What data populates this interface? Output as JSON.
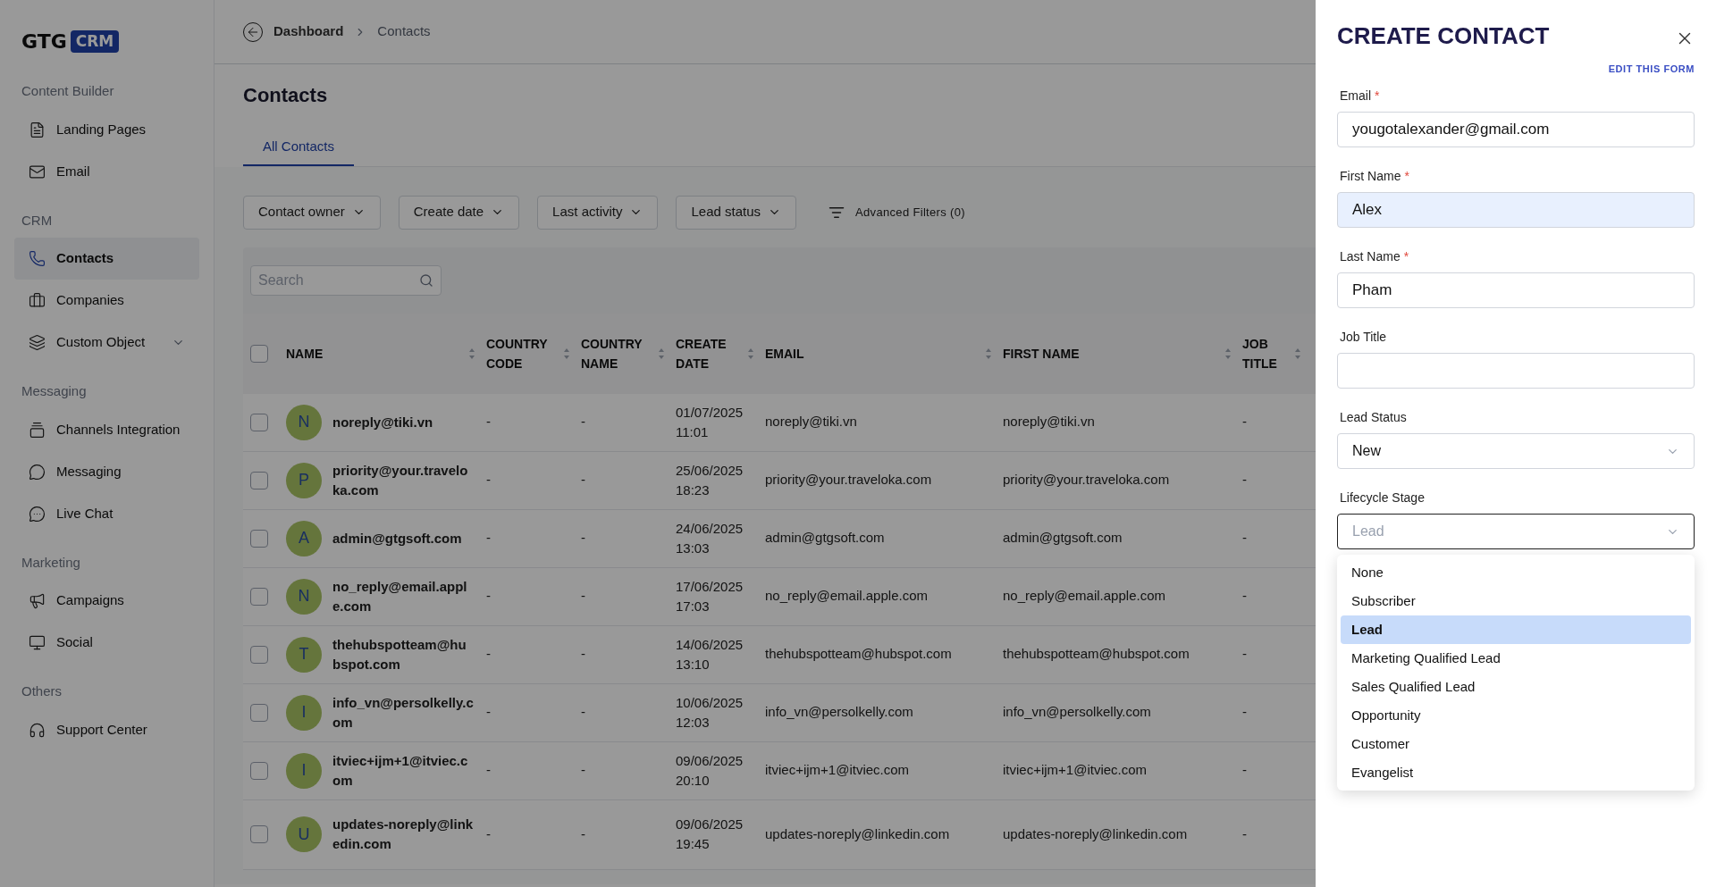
{
  "sidebar": {
    "logo": {
      "text": "GTG",
      "badge": "CRM"
    },
    "sections": [
      {
        "title": "Content Builder",
        "items": [
          {
            "label": "Landing Pages",
            "selected": false
          },
          {
            "label": "Email",
            "selected": false
          }
        ]
      },
      {
        "title": "CRM",
        "items": [
          {
            "label": "Contacts",
            "selected": true
          },
          {
            "label": "Companies",
            "selected": false
          },
          {
            "label": "Custom Object",
            "selected": false,
            "expandable": true
          }
        ]
      },
      {
        "title": "Messaging",
        "items": [
          {
            "label": "Channels Integration",
            "selected": false
          },
          {
            "label": "Messaging",
            "selected": false
          },
          {
            "label": "Live Chat",
            "selected": false
          }
        ]
      },
      {
        "title": "Marketing",
        "items": [
          {
            "label": "Campaigns",
            "selected": false
          },
          {
            "label": "Social",
            "selected": false
          }
        ]
      },
      {
        "title": "Others",
        "items": [
          {
            "label": "Support Center",
            "selected": false
          }
        ]
      }
    ]
  },
  "breadcrumb": [
    "Dashboard",
    "Contacts"
  ],
  "page_title": "Contacts",
  "tabs": [
    {
      "label": "All Contacts",
      "selected": true
    }
  ],
  "filters": [
    "Contact owner",
    "Create date",
    "Last activity",
    "Lead status"
  ],
  "advanced_filters": "Advanced Filters (0)",
  "search": {
    "placeholder": "Search"
  },
  "table": {
    "columns": [
      {
        "label": "NAME",
        "sortable": true
      },
      {
        "label": "COUNTRY CODE",
        "sortable": true
      },
      {
        "label": "COUNTRY NAME",
        "sortable": true
      },
      {
        "label": "CREATE DATE",
        "sortable": true
      },
      {
        "label": "EMAIL",
        "sortable": true
      },
      {
        "label": "FIRST NAME",
        "sortable": true
      },
      {
        "label": "JOB TITLE",
        "sortable": true
      }
    ],
    "all_checked": false,
    "rows": [
      {
        "checked": false,
        "initial": "N",
        "name": "noreply@tiki.vn",
        "country_code": "-",
        "country_name": "-",
        "create_date": "01/07/2025 11:01",
        "email": "noreply@tiki.vn",
        "first_name": "noreply@tiki.vn",
        "job_title": "-"
      },
      {
        "checked": false,
        "initial": "P",
        "name": "priority@your.traveloka.com",
        "country_code": "-",
        "country_name": "-",
        "create_date": "25/06/2025 18:23",
        "email": "priority@your.traveloka.com",
        "first_name": "priority@your.traveloka.com",
        "job_title": "-"
      },
      {
        "checked": false,
        "initial": "A",
        "name": "admin@gtgsoft.com",
        "country_code": "-",
        "country_name": "-",
        "create_date": "24/06/2025 13:03",
        "email": "admin@gtgsoft.com",
        "first_name": "admin@gtgsoft.com",
        "job_title": "-"
      },
      {
        "checked": false,
        "initial": "N",
        "name": "no_reply@email.apple.com",
        "country_code": "-",
        "country_name": "-",
        "create_date": "17/06/2025 17:03",
        "email": "no_reply@email.apple.com",
        "first_name": "no_reply@email.apple.com",
        "job_title": "-"
      },
      {
        "checked": false,
        "initial": "T",
        "name": "thehubspotteam@hubspot.com",
        "country_code": "-",
        "country_name": "-",
        "create_date": "14/06/2025 13:10",
        "email": "thehubspotteam@hubspot.com",
        "first_name": "thehubspotteam@hubspot.com",
        "job_title": "-"
      },
      {
        "checked": false,
        "initial": "I",
        "name": "info_vn@persolkelly.com",
        "country_code": "-",
        "country_name": "-",
        "create_date": "10/06/2025 12:03",
        "email": "info_vn@persolkelly.com",
        "first_name": "info_vn@persolkelly.com",
        "job_title": "-"
      },
      {
        "checked": false,
        "initial": "I",
        "name": "itviec+ijm+1@itviec.com",
        "country_code": "-",
        "country_name": "-",
        "create_date": "09/06/2025 20:10",
        "email": "itviec+ijm+1@itviec.com",
        "first_name": "itviec+ijm+1@itviec.com",
        "job_title": "-"
      },
      {
        "checked": false,
        "initial": "U",
        "name": "updates-noreply@linkedin.com",
        "country_code": "-",
        "country_name": "-",
        "create_date": "09/06/2025 19:45",
        "email": "updates-noreply@linkedin.com",
        "first_name": "updates-noreply@linkedin.com",
        "job_title": "-"
      }
    ]
  },
  "drawer": {
    "title": "CREATE CONTACT",
    "edit_link": "EDIT THIS FORM",
    "fields": [
      {
        "kind": "text",
        "label": "Email",
        "required_mark": "*",
        "value": "yougotalexander@gmail.com",
        "autofilled": false,
        "focused": false
      },
      {
        "kind": "text",
        "label": "First Name",
        "required_mark": "*",
        "value": "Alex",
        "autofilled": true,
        "focused": false
      },
      {
        "kind": "text",
        "label": "Last Name",
        "required_mark": "*",
        "value": "Pham",
        "autofilled": false,
        "focused": false
      },
      {
        "kind": "text",
        "label": "Job Title",
        "autofilled": false,
        "focused": false
      },
      {
        "kind": "select",
        "label": "Lead Status",
        "value": "New",
        "focused": false
      },
      {
        "kind": "select",
        "label": "Lifecycle Stage",
        "placeholder": "Lead",
        "focused": true,
        "options": [
          {
            "label": "None",
            "selected": false
          },
          {
            "label": "Subscriber",
            "selected": false
          },
          {
            "label": "Lead",
            "selected": true
          },
          {
            "label": "Marketing Qualified Lead",
            "selected": false
          },
          {
            "label": "Sales Qualified Lead",
            "selected": false
          },
          {
            "label": "Opportunity",
            "selected": false
          },
          {
            "label": "Customer",
            "selected": false
          },
          {
            "label": "Evangelist",
            "selected": false
          }
        ]
      }
    ]
  }
}
